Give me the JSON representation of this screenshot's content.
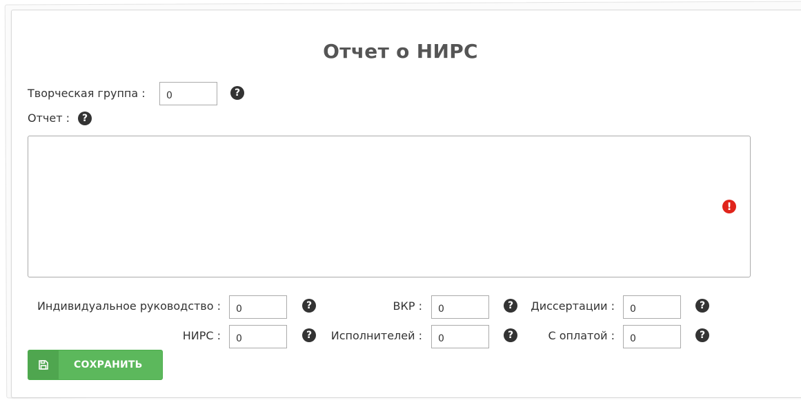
{
  "form": {
    "title": "Отчет о НИРС",
    "creative_group": {
      "label": "Творческая группа :",
      "value": "0"
    },
    "report": {
      "label": "Отчет :",
      "value": ""
    },
    "fields": {
      "individual": {
        "label": "Индивидуальное руководство :",
        "value": "0"
      },
      "vkr": {
        "label": "ВКР :",
        "value": "0"
      },
      "dissertations": {
        "label": "Диссертации :",
        "value": "0"
      },
      "nirs": {
        "label": "НИРС :",
        "value": "0"
      },
      "executors": {
        "label": "Исполнителей :",
        "value": "0"
      },
      "paid": {
        "label": "С оплатой :",
        "value": "0"
      }
    },
    "save_label": "СОХРАНИТЬ",
    "help_glyph": "?",
    "error_glyph": "!"
  },
  "icons": {
    "help": "question-circle-icon",
    "error": "exclamation-circle-icon",
    "save": "floppy-disk-icon"
  },
  "colors": {
    "save_button": "#5cb85c",
    "error": "#e0241b",
    "help": "#333333"
  }
}
